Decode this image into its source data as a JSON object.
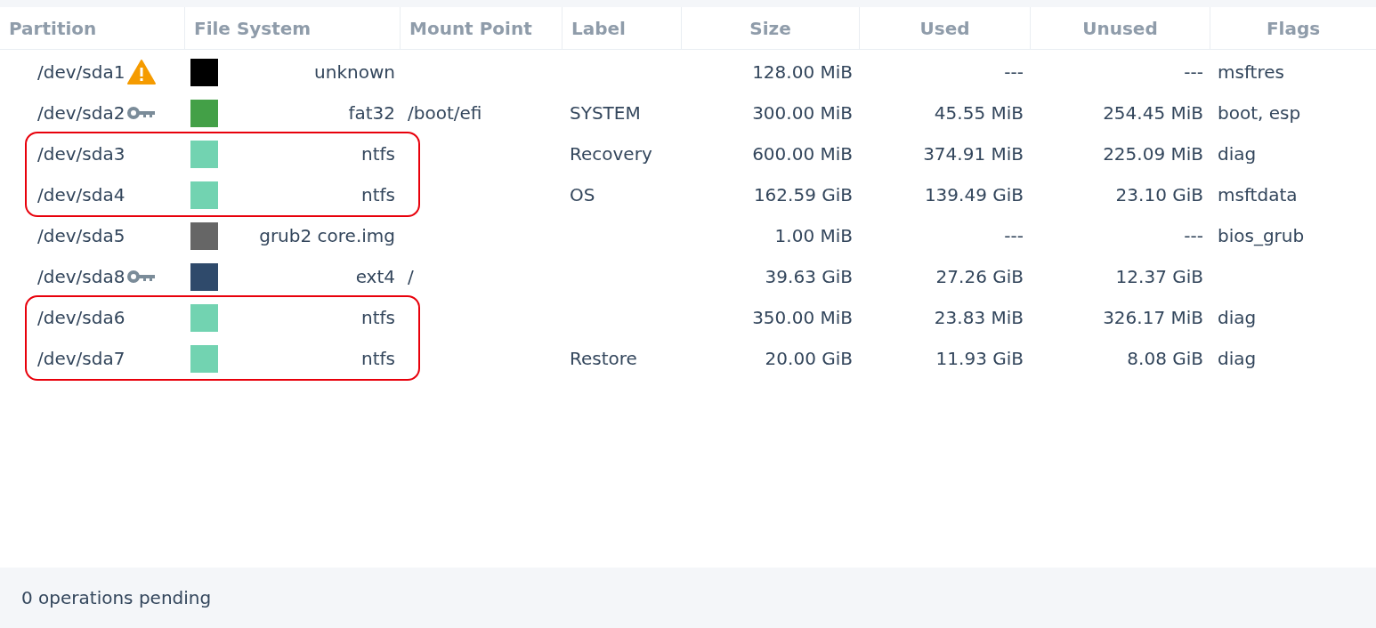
{
  "table": {
    "columns": [
      "Partition",
      "File System",
      "Mount Point",
      "Label",
      "Size",
      "Used",
      "Unused",
      "Flags"
    ],
    "rows": [
      {
        "partition": "/dev/sda1",
        "warning": true,
        "locked": false,
        "color": "#000000",
        "file_system": "unknown",
        "mount_point": "",
        "label": "",
        "size": "128.00 MiB",
        "used": "---",
        "unused": "---",
        "flags": "msftres",
        "circled": false
      },
      {
        "partition": "/dev/sda2",
        "warning": false,
        "locked": true,
        "color": "#43a047",
        "file_system": "fat32",
        "mount_point": "/boot/efi",
        "label": "SYSTEM",
        "size": "300.00 MiB",
        "used": "45.55 MiB",
        "unused": "254.45 MiB",
        "flags": "boot, esp",
        "circled": false
      },
      {
        "partition": "/dev/sda3",
        "warning": false,
        "locked": false,
        "color": "#72d3b1",
        "file_system": "ntfs",
        "mount_point": "",
        "label": "Recovery",
        "size": "600.00 MiB",
        "used": "374.91 MiB",
        "unused": "225.09 MiB",
        "flags": "diag",
        "circled": true
      },
      {
        "partition": "/dev/sda4",
        "warning": false,
        "locked": false,
        "color": "#72d3b1",
        "file_system": "ntfs",
        "mount_point": "",
        "label": "OS",
        "size": "162.59 GiB",
        "used": "139.49 GiB",
        "unused": "23.10 GiB",
        "flags": "msftdata",
        "circled": true
      },
      {
        "partition": "/dev/sda5",
        "warning": false,
        "locked": false,
        "color": "#666666",
        "file_system": "grub2 core.img",
        "mount_point": "",
        "label": "",
        "size": "1.00 MiB",
        "used": "---",
        "unused": "---",
        "flags": "bios_grub",
        "circled": false
      },
      {
        "partition": "/dev/sda8",
        "warning": false,
        "locked": true,
        "color": "#2f4a6b",
        "file_system": "ext4",
        "mount_point": "/",
        "label": "",
        "size": "39.63 GiB",
        "used": "27.26 GiB",
        "unused": "12.37 GiB",
        "flags": "",
        "circled": false
      },
      {
        "partition": "/dev/sda6",
        "warning": false,
        "locked": false,
        "color": "#72d3b1",
        "file_system": "ntfs",
        "mount_point": "",
        "label": "",
        "size": "350.00 MiB",
        "used": "23.83 MiB",
        "unused": "326.17 MiB",
        "flags": "diag",
        "circled": true
      },
      {
        "partition": "/dev/sda7",
        "warning": false,
        "locked": false,
        "color": "#72d3b1",
        "file_system": "ntfs",
        "mount_point": "",
        "label": "Restore",
        "size": "20.00 GiB",
        "used": "11.93 GiB",
        "unused": "8.08 GiB",
        "flags": "diag",
        "circled": true
      }
    ]
  },
  "status_bar": {
    "text": "0 operations pending"
  }
}
